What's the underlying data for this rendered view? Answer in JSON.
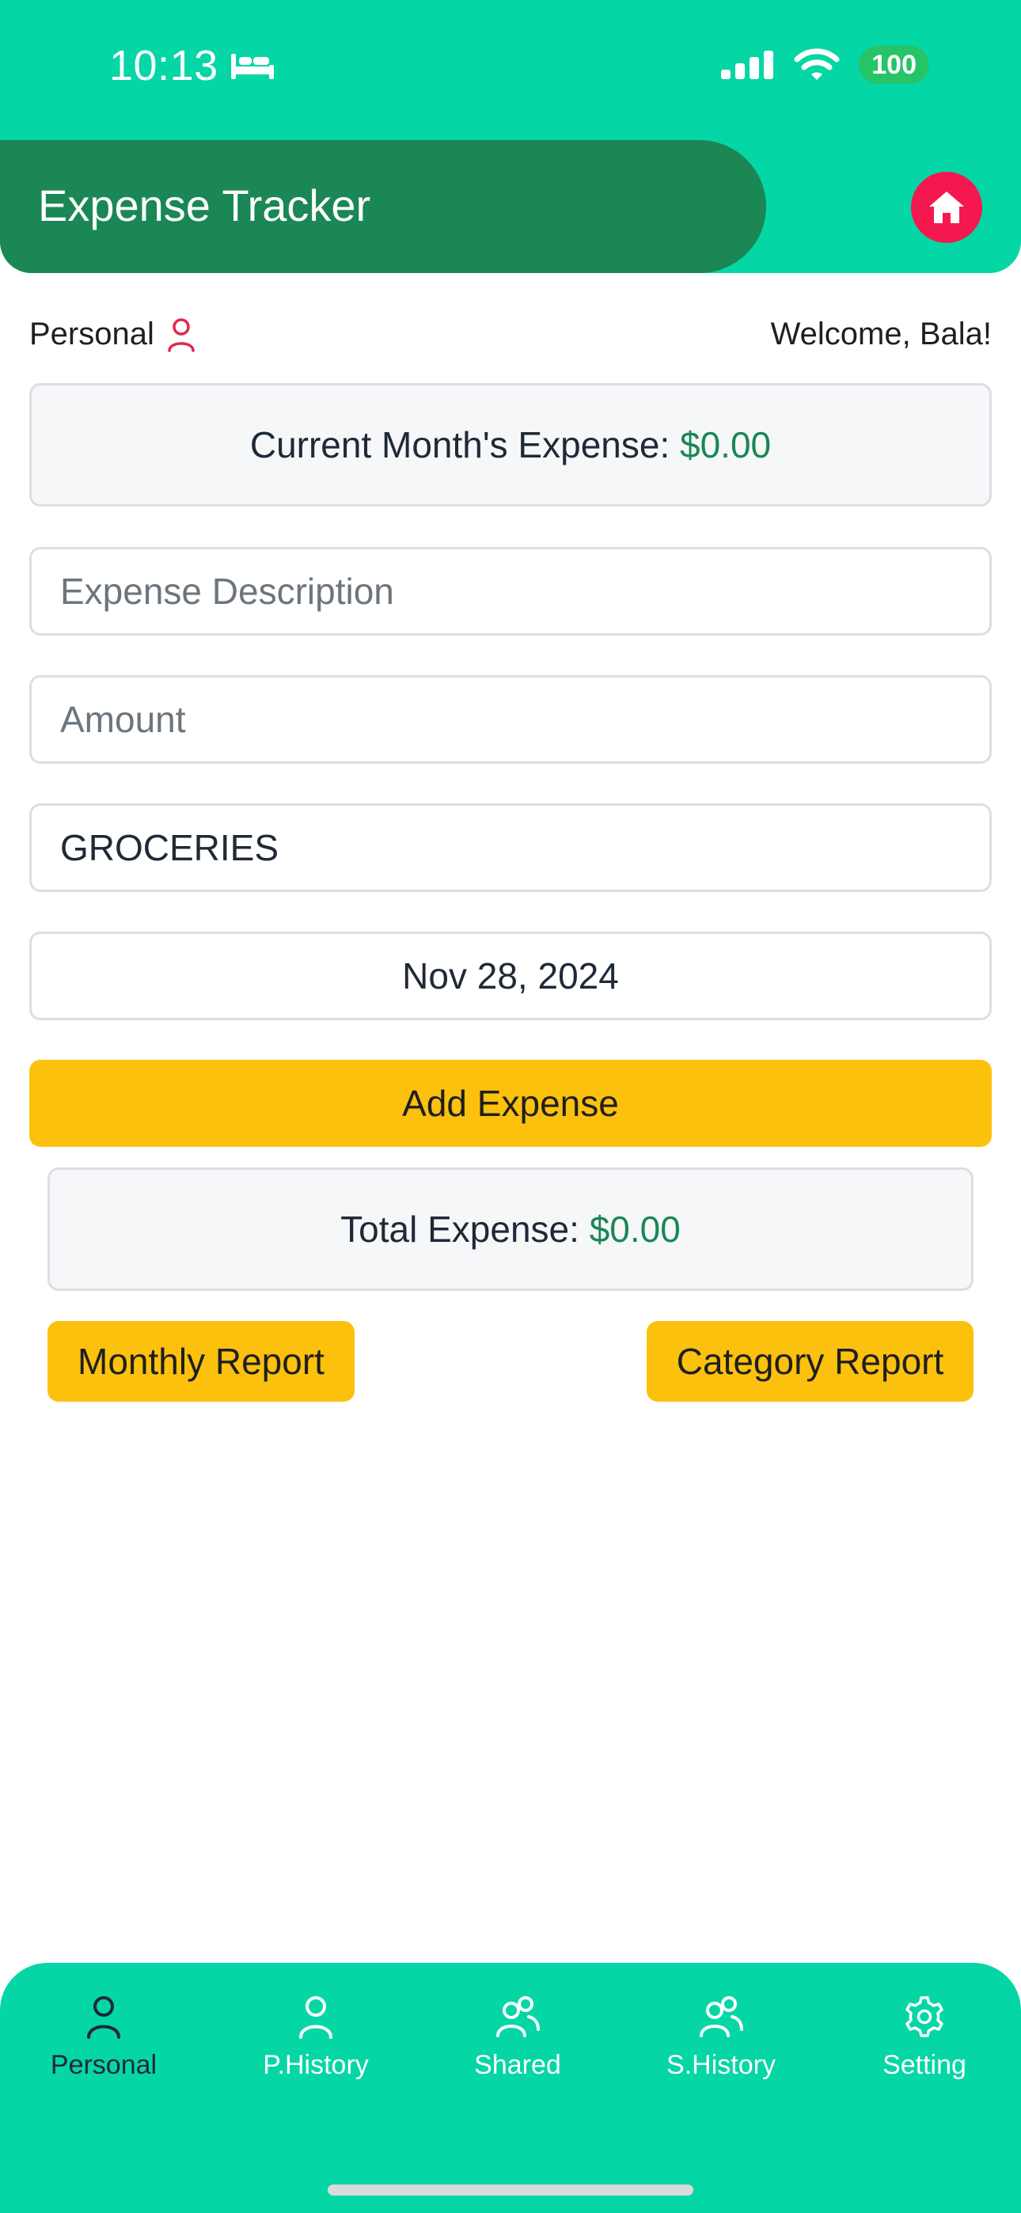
{
  "status_bar": {
    "time": "10:13",
    "battery": "100"
  },
  "header": {
    "title": "Expense Tracker"
  },
  "subheader": {
    "mode": "Personal",
    "welcome": "Welcome, Bala!"
  },
  "current_month": {
    "label": "Current Month's Expense:",
    "value": "$0.00"
  },
  "form": {
    "description_placeholder": "Expense Description",
    "amount_placeholder": "Amount",
    "category_value": "GROCERIES",
    "date_value": "Nov 28, 2024",
    "add_button": "Add Expense"
  },
  "total": {
    "label": "Total Expense:",
    "value": "$0.00"
  },
  "reports": {
    "monthly": "Monthly Report",
    "category": "Category Report"
  },
  "bottom_nav": {
    "items": [
      {
        "label": "Personal",
        "icon": "user-icon",
        "active": true
      },
      {
        "label": "P.History",
        "icon": "user-icon",
        "active": false
      },
      {
        "label": "Shared",
        "icon": "users-icon",
        "active": false
      },
      {
        "label": "S.History",
        "icon": "users-icon",
        "active": false
      },
      {
        "label": "Setting",
        "icon": "gear-icon",
        "active": false
      }
    ]
  },
  "colors": {
    "teal": "#05d6a6",
    "dark_green": "#1a8754",
    "accent_red": "#f4184f",
    "yellow": "#fcc10d",
    "money_green": "#1a8754"
  }
}
